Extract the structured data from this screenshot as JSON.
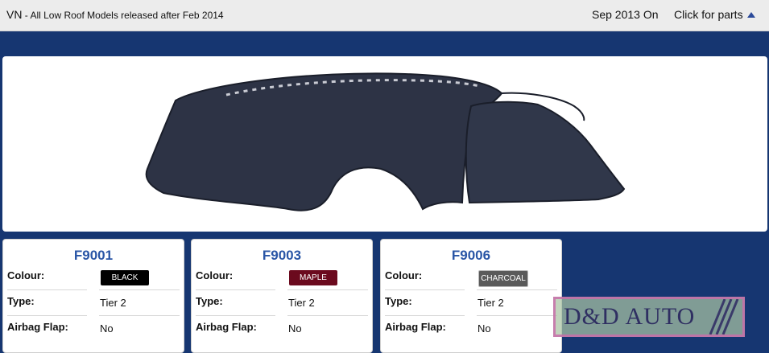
{
  "header": {
    "model_code": "VN",
    "model_desc": " - All Low Roof Models released after Feb 2014",
    "date_range": "Sep 2013 On",
    "parts_link": "Click for parts"
  },
  "products": [
    {
      "code": "F9001",
      "colour_label": "Colour:",
      "colour": "BLACK",
      "colour_hex": "#000000",
      "type_label": "Type:",
      "type": "Tier 2",
      "airbag_label": "Airbag Flap:",
      "airbag": "No"
    },
    {
      "code": "F9003",
      "colour_label": "Colour:",
      "colour": "MAPLE",
      "colour_hex": "#6b0a1e",
      "type_label": "Type:",
      "type": "Tier 2",
      "airbag_label": "Airbag Flap:",
      "airbag": "No"
    },
    {
      "code": "F9006",
      "colour_label": "Colour:",
      "colour": "CHARCOAL",
      "colour_hex": "#5a5a5a",
      "type_label": "Type:",
      "type": "Tier 2",
      "airbag_label": "Airbag Flap:",
      "airbag": "No"
    }
  ],
  "watermark": {
    "text": "D&D AUTO"
  },
  "colors": {
    "background": "#163671",
    "accent": "#2a56a6",
    "dashmat": "#2d3345"
  }
}
